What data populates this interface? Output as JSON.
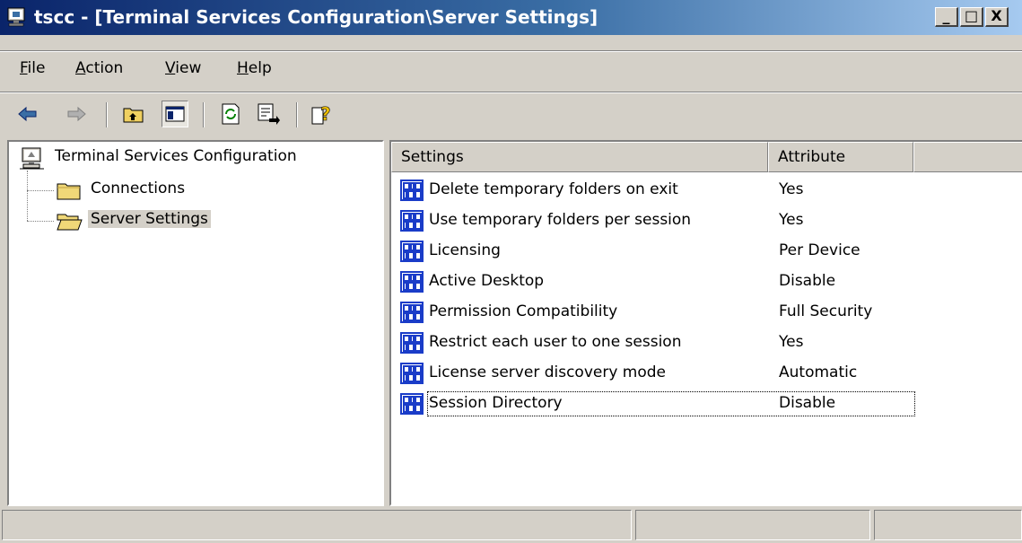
{
  "window": {
    "title": "tscc - [Terminal Services Configuration\\Server Settings]",
    "buttons": {
      "minimize": "_",
      "maximize": "□",
      "close": "X"
    }
  },
  "menu": {
    "items": [
      {
        "accel": "F",
        "rest": "ile"
      },
      {
        "accel": "A",
        "rest": "ction"
      },
      {
        "accel": "V",
        "rest": "iew"
      },
      {
        "accel": "H",
        "rest": "elp"
      }
    ]
  },
  "toolbar": {
    "icons": [
      "back-arrow-icon",
      "forward-arrow-icon",
      "up-one-level-icon",
      "show-hide-console-tree-icon",
      "refresh-icon",
      "export-list-icon",
      "help-icon"
    ]
  },
  "tree": {
    "root": "Terminal Services Configuration",
    "children": [
      "Connections",
      "Server Settings"
    ]
  },
  "list": {
    "columns": [
      "Settings",
      "Attribute"
    ],
    "rows": [
      {
        "setting": "Delete temporary folders on exit",
        "attribute": "Yes"
      },
      {
        "setting": "Use temporary folders per session",
        "attribute": "Yes"
      },
      {
        "setting": "Licensing",
        "attribute": "Per Device"
      },
      {
        "setting": "Active Desktop",
        "attribute": "Disable"
      },
      {
        "setting": "Permission Compatibility",
        "attribute": "Full Security"
      },
      {
        "setting": "Restrict each user to one session",
        "attribute": "Yes"
      },
      {
        "setting": "License server discovery mode",
        "attribute": "Automatic"
      },
      {
        "setting": "Session Directory",
        "attribute": "Disable"
      }
    ]
  },
  "colors": {
    "titlebar_start": "#0a246a",
    "titlebar_end": "#a6caf0",
    "chrome": "#d4d0c8",
    "setting_icon": "#1a3cc8"
  }
}
